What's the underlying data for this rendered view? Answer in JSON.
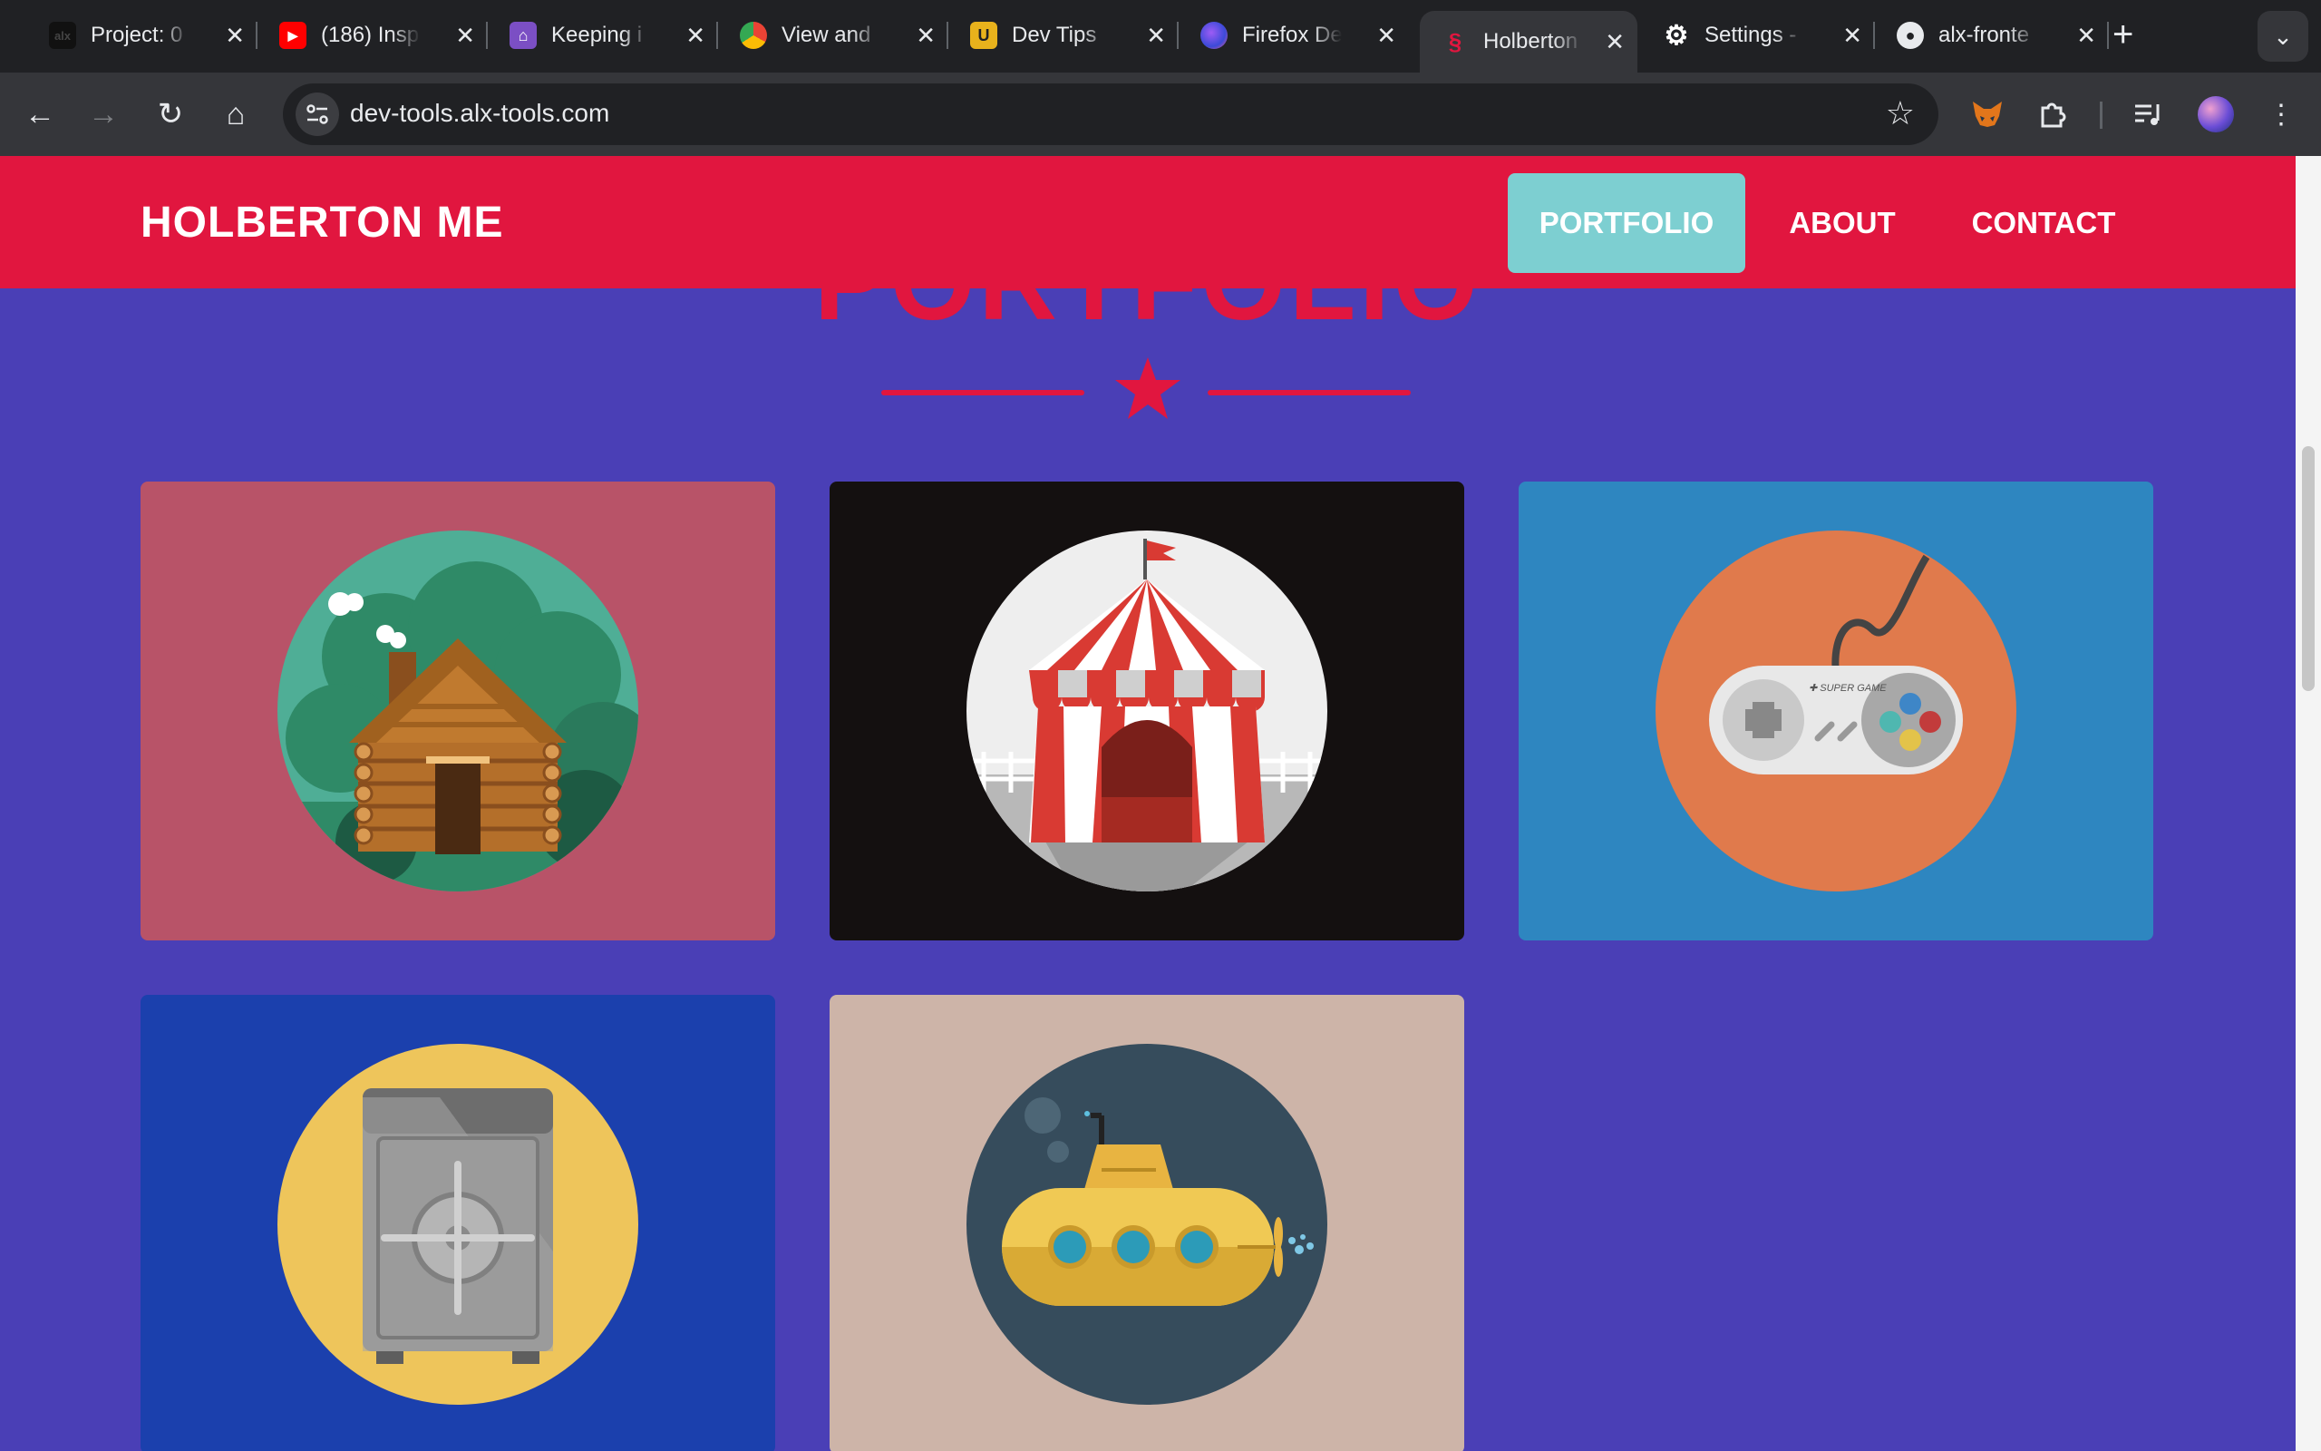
{
  "browser": {
    "tabs": [
      {
        "title": "Project: 0",
        "active": false
      },
      {
        "title": "(186) Insp",
        "active": false
      },
      {
        "title": "Keeping i",
        "active": false
      },
      {
        "title": "View and",
        "active": false
      },
      {
        "title": "Dev Tips",
        "active": false
      },
      {
        "title": "Firefox De",
        "active": false
      },
      {
        "title": "Holberton",
        "active": true
      },
      {
        "title": "Settings -",
        "active": false
      },
      {
        "title": "alx-fronte",
        "active": false
      }
    ],
    "url": "dev-tools.alx-tools.com"
  },
  "site": {
    "logo": "HOLBERTON ME",
    "nav": [
      {
        "label": "PORTFOLIO",
        "current": true
      },
      {
        "label": "ABOUT",
        "current": false
      },
      {
        "label": "CONTACT",
        "current": false
      }
    ],
    "section_title": "PORTFOLIO",
    "portfolio": [
      {
        "illustration": "log-cabin-icon",
        "card_color": "#b85368",
        "circle_color": "#4fae96"
      },
      {
        "illustration": "circus-tent-icon",
        "card_color": "#141010",
        "circle_color": "#eeeeee"
      },
      {
        "illustration": "game-controller-icon",
        "card_color": "#2e86c0",
        "circle_color": "#e07a4c"
      },
      {
        "illustration": "safe-icon",
        "card_color": "#1b40ad",
        "circle_color": "#eec55b"
      },
      {
        "illustration": "submarine-icon",
        "card_color": "#cdb4a8",
        "circle_color": "#364c5c"
      }
    ]
  },
  "colors": {
    "brand_red": "#e1163f",
    "page_bg": "#4a3fb6",
    "nav_active": "#7dcfd1"
  }
}
